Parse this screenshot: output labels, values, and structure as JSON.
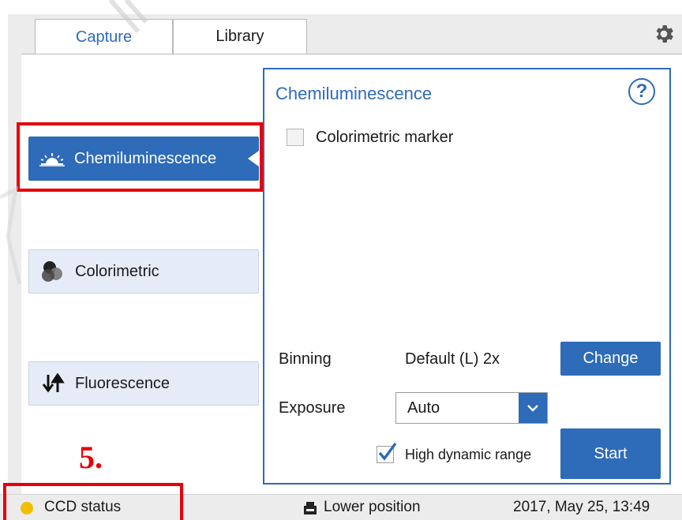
{
  "tabs": [
    {
      "label": "Capture",
      "active": true
    },
    {
      "label": "Library",
      "active": false
    }
  ],
  "modes": [
    {
      "label": "Chemiluminescence",
      "icon": "sunrise-icon",
      "selected": true
    },
    {
      "label": "Colorimetric",
      "icon": "color-circles-icon",
      "selected": false
    },
    {
      "label": "Fluorescence",
      "icon": "up-down-arrows-icon",
      "selected": false
    }
  ],
  "panel": {
    "title": "Chemiluminescence",
    "help_label": "?",
    "colorimetric_marker_label": "Colorimetric marker",
    "colorimetric_marker_checked": false,
    "binning_label": "Binning",
    "binning_value": "Default (L) 2x",
    "change_label": "Change",
    "exposure_label": "Exposure",
    "exposure_value": "Auto",
    "hdr_label": "High dynamic range",
    "hdr_checked": true,
    "start_label": "Start"
  },
  "annotation": "5.",
  "status_bar": {
    "ccd_status": "CCD status",
    "position": "Lower position",
    "datetime": "2017, May 25, 13:49"
  },
  "colors": {
    "accent": "#2e6bb8",
    "highlight": "#e8000b",
    "status_dot": "#f0c000",
    "mode_bg": "#e6ecf7"
  }
}
